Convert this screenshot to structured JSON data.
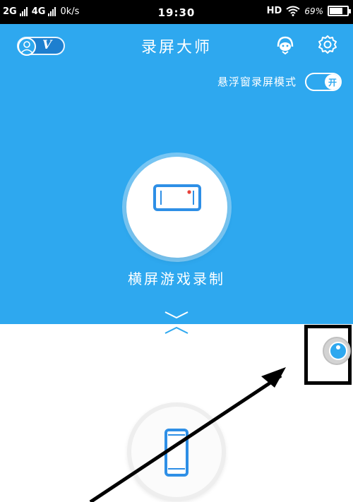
{
  "status_bar": {
    "left_net1": "2G",
    "left_net2": "4G",
    "speed": "0k/s",
    "time": "19:30",
    "hd": "HD",
    "battery": "69%"
  },
  "header": {
    "title": "录屏大师",
    "vip_label": "V",
    "support_icon": "headset-icon",
    "settings_icon": "gear-icon"
  },
  "float_mode": {
    "label": "悬浮窗录屏模式",
    "toggle_text": "开",
    "enabled": true
  },
  "main_action": {
    "label": "横屏游戏录制",
    "icon": "landscape-phone-icon"
  },
  "secondary_action": {
    "icon": "portrait-phone-icon"
  },
  "floating_ball": {
    "icon": "record-ball-icon"
  },
  "colors": {
    "brand_blue": "#2ea8ef",
    "accent_red": "#e8423b",
    "annotation": "#000000"
  }
}
